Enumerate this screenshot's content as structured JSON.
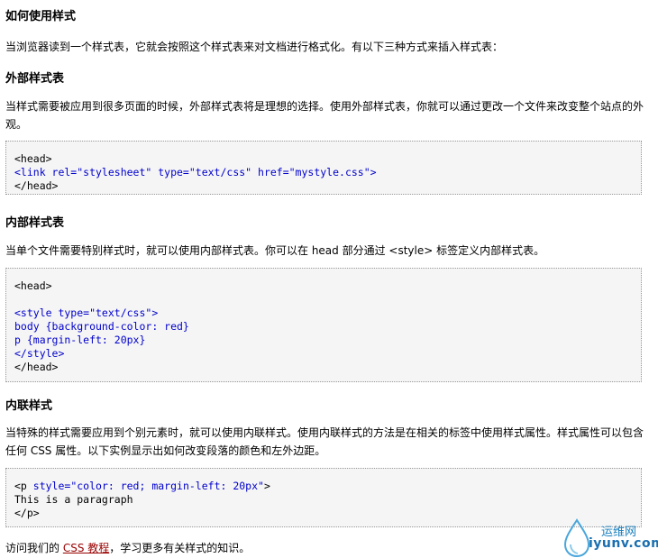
{
  "section_main": {
    "title": "如何使用样式",
    "intro": "当浏览器读到一个样式表，它就会按照这个样式表来对文档进行格式化。有以下三种方式来插入样式表："
  },
  "external": {
    "title": "外部样式表",
    "line1": "当样式需要被应用到很多页面的时候，外部样式表将是理想的选择。使用外部样式表，你就可以通过更改一个文件来改变整个站点的外",
    "line2": "观。",
    "code": [
      "<head>",
      "<link rel=\"stylesheet\" type=\"text/css\" href=\"mystyle.css\">",
      "</head>"
    ]
  },
  "internal": {
    "title": "内部样式表",
    "desc": "当单个文件需要特别样式时，就可以使用内部样式表。你可以在 head 部分通过 <style> 标签定义内部样式表。",
    "code": [
      "<head>",
      "",
      "<style type=\"text/css\">",
      "body {background-color: red}",
      "p {margin-left: 20px}",
      "</style>",
      "</head>"
    ]
  },
  "inline": {
    "title": "内联样式",
    "line1": "当特殊的样式需要应用到个别元素时，就可以使用内联样式。使用内联样式的方法是在相关的标签中使用样式属性。样式属性可以包含",
    "line2": "任何 CSS 属性。以下实例显示出如何改变段落的颜色和左外边距。",
    "code": [
      "<p style=\"color: red; margin-left: 20px\">",
      "This is a paragraph",
      "</p>"
    ]
  },
  "footer": {
    "prefix": "访问我们的 ",
    "link": "CSS 教程",
    "suffix": "，学习更多有关样式的知识。"
  },
  "watermark": {
    "text1": "运维网",
    "text2": "iyunv.com"
  },
  "colors": {
    "code_keyword": "#0000cc",
    "link": "#990000",
    "code_bg": "#f5f5f5"
  }
}
